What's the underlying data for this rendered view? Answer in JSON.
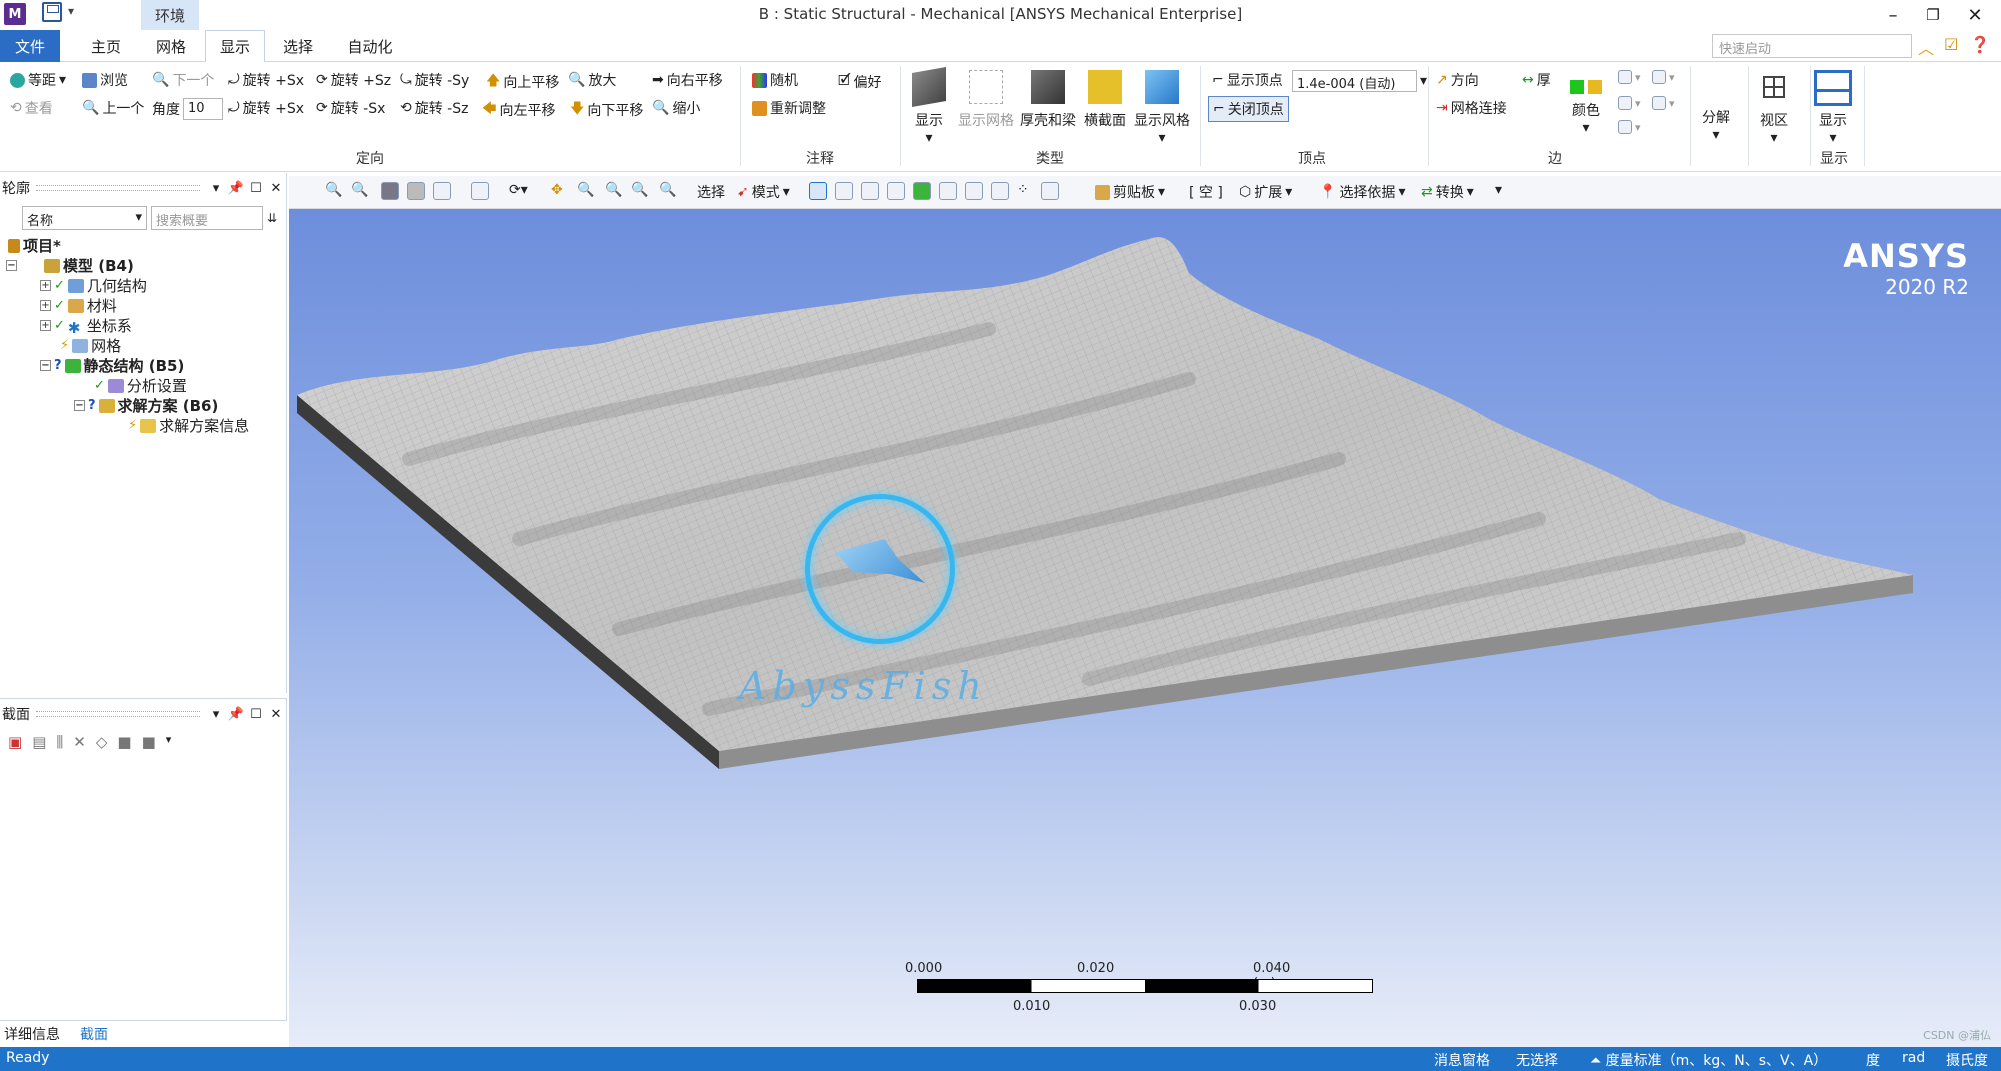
{
  "titlebar": {
    "app_icon": "M",
    "context_tab_group": "环境",
    "window_title": "B : Static Structural - Mechanical [ANSYS Mechanical Enterprise]",
    "minimize": "–",
    "restore": "❐",
    "close": "✕"
  },
  "tabs": {
    "file": "文件",
    "home": "主页",
    "mesh": "网格",
    "display": "显示",
    "selection": "选择",
    "automation": "自动化",
    "quick_launch_placeholder": "快速启动"
  },
  "ribbon": {
    "orient": {
      "iso": "等距",
      "browse": "浏览",
      "next": "下一个",
      "rot_px": "旋转 +Sx",
      "rot_pz": "旋转 +Sz",
      "rot_my": "旋转 -Sy",
      "pan_up": "向上平移",
      "zoom_in": "放大",
      "pan_right": "向右平移",
      "look": "查看",
      "previous": "上一个",
      "angle_label": "角度",
      "angle_value": "10",
      "rot_px2": "旋转 +Sx",
      "rot_mx": "旋转 -Sx",
      "rot_mz": "旋转 -Sz",
      "pan_left": "向左平移",
      "pan_down": "向下平移",
      "zoom_out": "缩小",
      "label": "定向"
    },
    "annotation": {
      "random": "随机",
      "preference": "偏好",
      "readjust": "重新调整",
      "label": "注释"
    },
    "type": {
      "show": "显示",
      "show_mesh": "显示网格",
      "shell_beam": "厚壳和梁",
      "cross_section": "横截面",
      "show_style": "显示风格",
      "label": "类型"
    },
    "vertex": {
      "show_vertex": "显示顶点",
      "vertex_value": "1.4e-004 (自动)",
      "close_vertex": "关闭顶点",
      "label": "顶点"
    },
    "edges": {
      "direction": "方向",
      "thick": "厚",
      "mesh_connection": "网格连接",
      "color": "颜色",
      "label": "边"
    },
    "explode": "分解",
    "viewports": "视区",
    "display_btn": "显示",
    "display_group": "显示"
  },
  "outline": {
    "title": "轮廓",
    "filter_name": "名称",
    "search_placeholder": "搜索概要",
    "tree": {
      "project": "项目*",
      "model": "模型 (B4)",
      "geometry": "几何结构",
      "materials": "材料",
      "coordinates": "坐标系",
      "mesh": "网格",
      "static": "静态结构 (B5)",
      "analysis_settings": "分析设置",
      "solution": "求解方案 (B6)",
      "solution_info": "求解方案信息"
    }
  },
  "section_panel": {
    "title": "截面",
    "tabs": [
      "详细信息",
      "截面"
    ]
  },
  "graphics_toolbar": {
    "select": "选择",
    "mode": "模式",
    "clipboard": "剪贴板",
    "empty": "[ 空 ]",
    "extend": "扩展",
    "select_by": "选择依据",
    "convert": "转换"
  },
  "viewport": {
    "brand": "ANSYS",
    "version": "2020 R2",
    "watermark": "AbyssFish",
    "scale": {
      "t0": "0.000",
      "t020": "0.020",
      "t040": "0.040 (m)",
      "t010": "0.010",
      "t030": "0.030"
    },
    "csdn": "CSDN @浦仏"
  },
  "statusbar": {
    "ready": "Ready",
    "messages": "消息窗格",
    "no_selection": "无选择",
    "units": "度量标准（m、kg、N、s、V、A）",
    "degree": "度",
    "rad": "rad",
    "temp": "摄氏度"
  },
  "colors": {
    "file_tab": "#2b6cc4",
    "status_bar": "#1f74c9",
    "viewport_top": "#6d8edc",
    "viewport_bottom": "#e7ecf8",
    "mesh_surface": "#c8c8c8"
  }
}
